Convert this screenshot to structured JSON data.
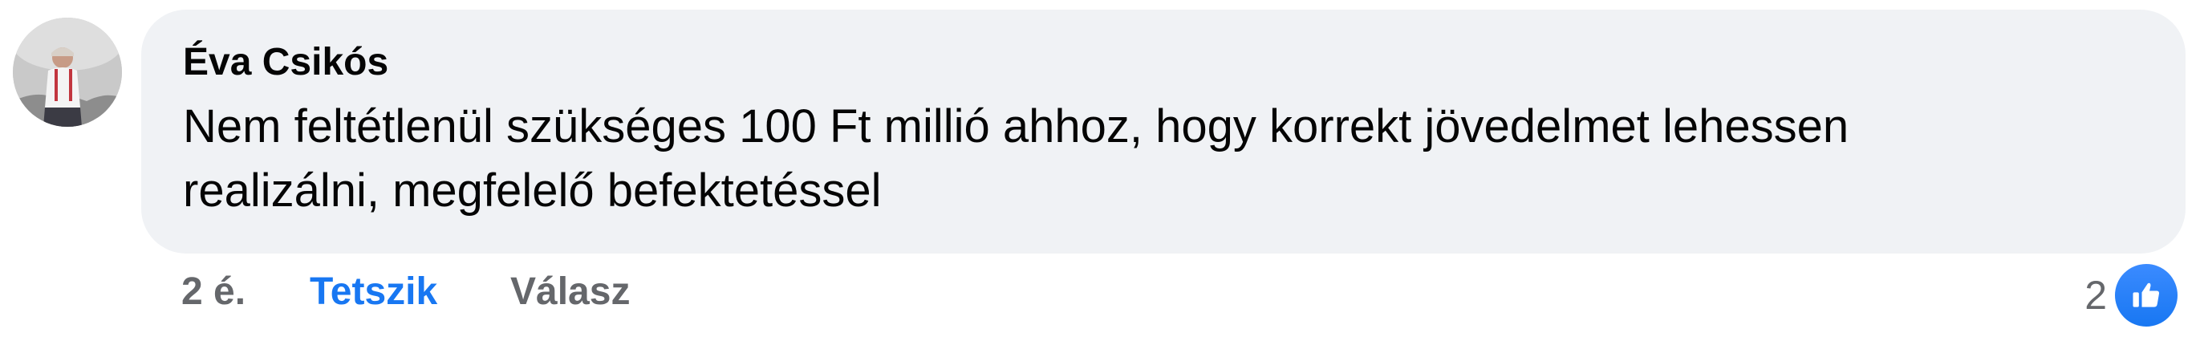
{
  "comment": {
    "author": "Éva Csikós",
    "text_lines": [
      "Nem feltétlenül szükséges 100 Ft millió ahhoz, hogy korrekt jövedelmet lehessen",
      "realizálni, megfelelő befektetéssel"
    ],
    "avatar_icon": "user-avatar-photo"
  },
  "actions": {
    "timestamp": "2 é.",
    "like_label": "Tetszik",
    "reply_label": "Válasz"
  },
  "reactions": {
    "count": "2",
    "icon": "thumbs-up-icon"
  },
  "colors": {
    "bubble_bg": "#f0f2f5",
    "accent": "#1877f2",
    "muted_text": "#65676b",
    "text": "#050505"
  }
}
